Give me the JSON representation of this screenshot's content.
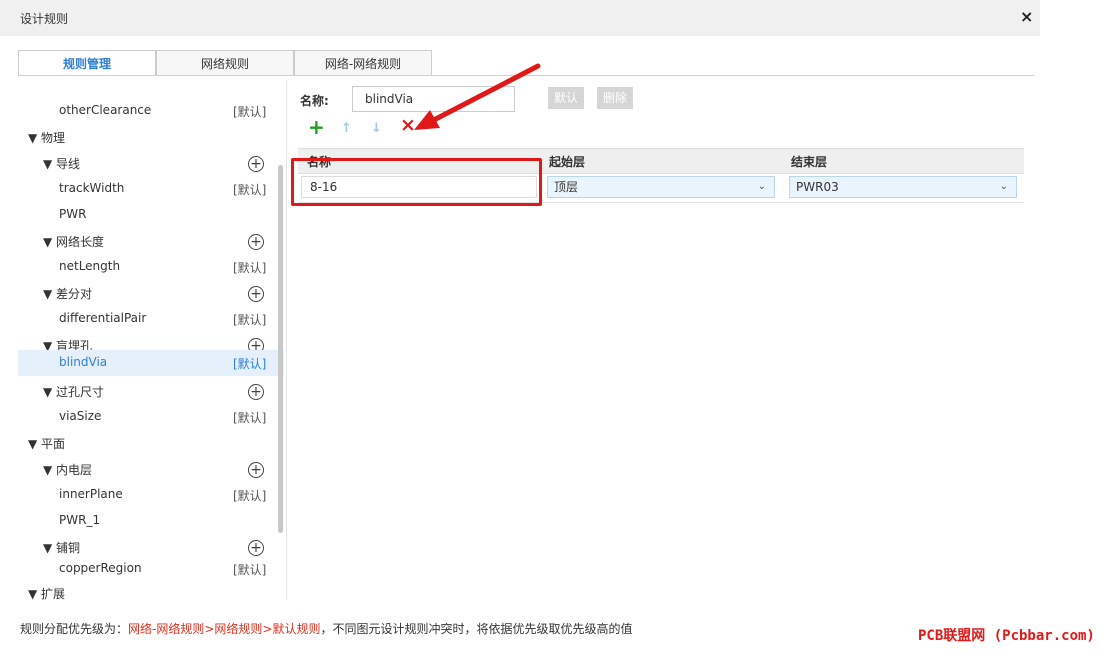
{
  "window": {
    "title": "设计规则"
  },
  "tabs": [
    {
      "label": "规则管理",
      "active": true
    },
    {
      "label": "网络规则",
      "active": false
    },
    {
      "label": "网络-网络规则",
      "active": false
    }
  ],
  "sidebar": {
    "items": [
      {
        "label": "otherClearance",
        "default": "[默认]"
      },
      {
        "label": "▼ 物理"
      },
      {
        "label": "▼ 导线"
      },
      {
        "label": "trackWidth",
        "default": "[默认]"
      },
      {
        "label": "PWR"
      },
      {
        "label": "▼ 网络长度"
      },
      {
        "label": "netLength",
        "default": "[默认]"
      },
      {
        "label": "▼ 差分对"
      },
      {
        "label": "differentialPair",
        "default": "[默认]"
      },
      {
        "label": "▼ 盲埋孔"
      },
      {
        "label": "blindVia",
        "default": "[默认]"
      },
      {
        "label": "▼ 过孔尺寸"
      },
      {
        "label": "viaSize",
        "default": "[默认]"
      },
      {
        "label": "▼ 平面"
      },
      {
        "label": "▼ 内电层"
      },
      {
        "label": "innerPlane",
        "default": "[默认]"
      },
      {
        "label": "PWR_1"
      },
      {
        "label": "▼ 铺铜"
      },
      {
        "label": "copperRegion",
        "default": "[默认]"
      },
      {
        "label": "▼ 扩展"
      }
    ],
    "add_glyph": "+"
  },
  "editor": {
    "name_label": "名称:",
    "name_value": "blindVia",
    "default_button": "默认",
    "delete_button": "删除",
    "toolbar": {
      "add": "+",
      "up": "↑",
      "down": "↓",
      "remove": "×"
    },
    "columns": [
      "名称",
      "起始层",
      "结束层"
    ],
    "rows": [
      {
        "name": "8-16",
        "start_layer": "顶层",
        "end_layer": "PWR03"
      }
    ],
    "select_chevron": "⌄"
  },
  "footer": {
    "prefix": "规则分配优先级为：",
    "priority": "网络-网络规则>网络规则>默认规则",
    "suffix": "，不同图元设计规则冲突时，将依据优先级取优先级高的值"
  },
  "watermark": "PCB联盟网 (Pcbbar.com)",
  "colors": {
    "accent": "#2b7fd6",
    "add": "#1e9e1e",
    "remove": "#e01818",
    "arrows": "#9ec8f0",
    "highlight": "#e01818"
  }
}
